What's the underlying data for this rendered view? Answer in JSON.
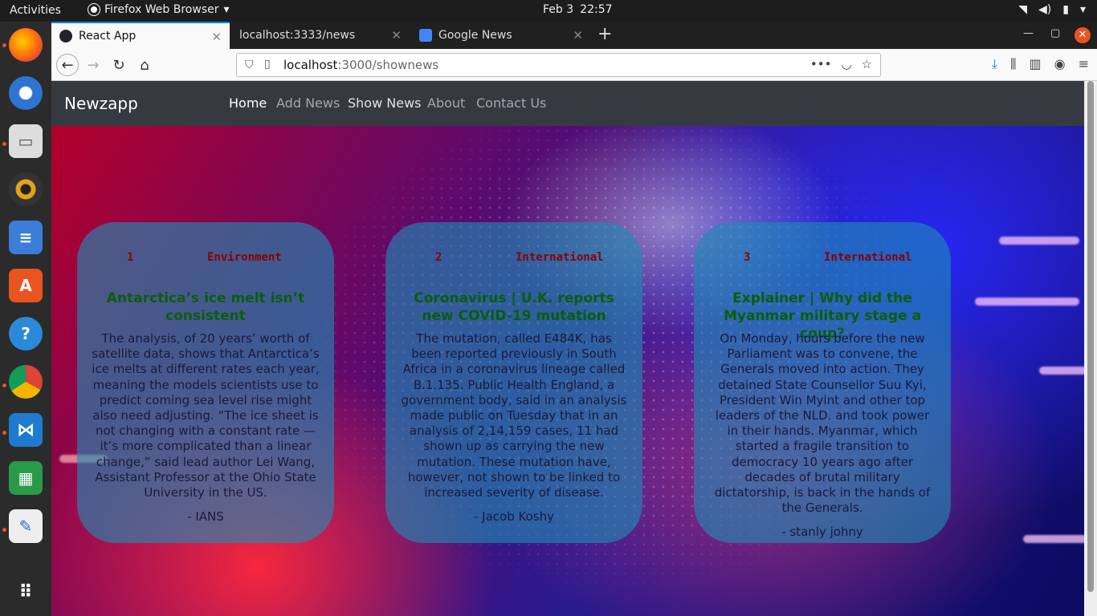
{
  "system": {
    "activities": "Activities",
    "app_menu": "Firefox Web Browser",
    "date": "Feb 3",
    "time": "22:57"
  },
  "browser": {
    "tabs": [
      {
        "label": "React App",
        "active": true
      },
      {
        "label": "localhost:3333/news",
        "active": false
      },
      {
        "label": "Google News",
        "active": false
      }
    ],
    "url_host": "localhost",
    "url_path": ":3000/shownews"
  },
  "app": {
    "brand": "Newzapp",
    "nav": [
      "Home",
      "Add News",
      "Show News",
      "About",
      "Contact Us"
    ],
    "active_nav": "Home"
  },
  "news": [
    {
      "id": "1",
      "category": "Environment",
      "title": "Antarctica’s ice melt isn’t consistent",
      "body": "The analysis, of 20 years’ worth of satellite data, shows that Antarctica’s ice melts at different rates each year, meaning the models scientists use to predict coming sea level rise might also need adjusting. “The ice sheet is not changing with a constant rate — it’s more complicated than a linear change,” said lead author Lei Wang, Assistant Professor at the Ohio State University in the US.",
      "author": "- IANS"
    },
    {
      "id": "2",
      "category": "International",
      "title": "Coronavirus | U.K. reports new COVID-19 mutation",
      "body": "The mutation, called E484K, has been reported previously in South Africa in a coronavirus lineage called B.1.135. Public Health England, a government body, said in an analysis made public on Tuesday that in an analysis of 2,14,159 cases, 11 had shown up as carrying the new mutation. These mutation have, however, not shown to be linked to increased severity of disease.",
      "author": "- Jacob Koshy"
    },
    {
      "id": "3",
      "category": "International",
      "title": "Explainer | Why did the Myanmar military stage a coup?",
      "body": "On Monday, hours before the new Parliament was to convene, the Generals moved into action. They detained State Counsellor Suu Kyi, President Win Myint and other top leaders of the NLD. and took power in their hands. Myanmar, which started a fragile transition to democracy 10 years ago after decades of brutal military dictatorship, is back in the hands of the Generals.",
      "author": "- stanly johny"
    }
  ]
}
